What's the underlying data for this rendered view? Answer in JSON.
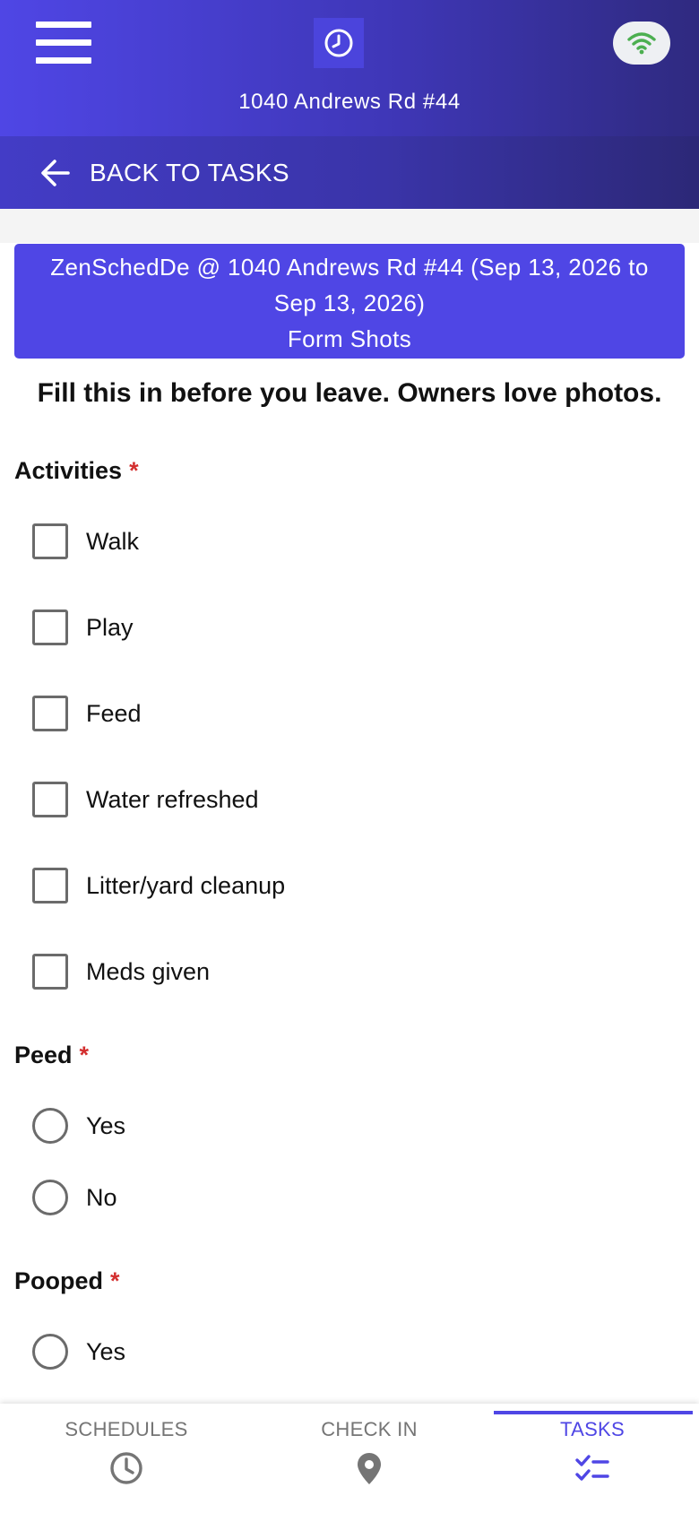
{
  "header": {
    "address": "1040 Andrews Rd #44",
    "back_label": "BACK TO TASKS",
    "icons": {
      "menu": "hamburger-menu-icon",
      "logo": "clock-icon",
      "connection": "wifi-icon"
    },
    "colors": {
      "primary": "#4f46e5",
      "wifi": "#4caf50"
    }
  },
  "banner": {
    "title": "ZenSchedDe @ 1040 Andrews Rd #44 (Sep 13, 2026 to Sep 13, 2026)",
    "subtitle": "Form Shots"
  },
  "form": {
    "instructions": "Fill this in before you leave. Owners love photos.",
    "activities": {
      "label": "Activities",
      "required_mark": "*",
      "options": [
        "Walk",
        "Play",
        "Feed",
        "Water refreshed",
        "Litter/yard cleanup",
        "Meds given"
      ]
    },
    "peed": {
      "label": "Peed",
      "required_mark": "*",
      "options": [
        "Yes",
        "No"
      ]
    },
    "pooped": {
      "label": "Pooped",
      "required_mark": "*",
      "options": [
        "Yes"
      ]
    }
  },
  "bottom_nav": {
    "tabs": [
      {
        "label": "SCHEDULES",
        "icon": "clock-icon",
        "active": false
      },
      {
        "label": "CHECK IN",
        "icon": "location-pin-icon",
        "active": false
      },
      {
        "label": "TASKS",
        "icon": "task-checklist-icon",
        "active": true
      }
    ],
    "colors": {
      "active": "#4f46e5",
      "inactive": "#757575"
    }
  }
}
